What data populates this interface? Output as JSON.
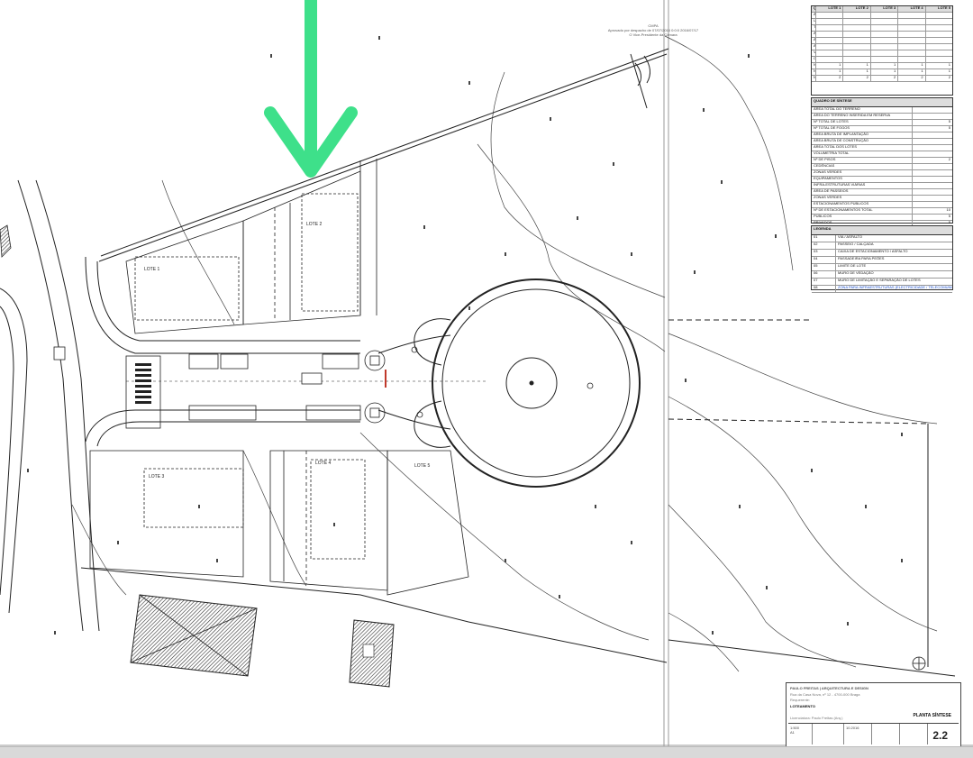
{
  "approval_stamp": {
    "line1": "CMPA",
    "line2": "Aprovado por despacho de 07/07/2016 0:0:0 2016/07/17",
    "line3": "O Vice-Presidente da Câmara"
  },
  "colors": {
    "arrow": "#3ee08a",
    "lines": "#222222",
    "building_hatch": "#333333",
    "legend_blue": "#1a4fd0"
  },
  "annotation": {
    "type": "down-arrow",
    "color": "#3ee08a",
    "points_at": "property boundary line"
  },
  "lot_table": {
    "header": [
      "QUADRO DE SÍNTESE",
      "LOTE 1",
      "LOTE 2",
      "LOTE 3",
      "LOTE 4",
      "LOTE 5"
    ],
    "rows": [
      [
        "ÁREA DO LOTE",
        "",
        "",
        "",
        "",
        ""
      ],
      [
        "USO / OCUPAÇÃO",
        "",
        "",
        "",
        "",
        ""
      ],
      [
        "TIPOLOGIA",
        "",
        "",
        "",
        "",
        ""
      ],
      [
        "ÁREA TOTAL",
        "",
        "",
        "",
        "",
        ""
      ],
      [
        "ÁREA IMPLANTAÇÃO",
        "",
        "",
        "",
        "",
        ""
      ],
      [
        "ÁREA CONSTRUÇÃO",
        "",
        "",
        "",
        "",
        ""
      ],
      [
        "VOLUMETRIA",
        "",
        "",
        "",
        "",
        ""
      ],
      [
        "CÉRCEA MÁXIMA",
        "",
        "",
        "",
        "",
        ""
      ],
      [
        "Nº DE PISOS ACIMA COTA SOLEIRA",
        "1",
        "1",
        "1",
        "1",
        "1"
      ],
      [
        "Nº DE PISOS ABAIXO COTA SOLEIRA",
        "1",
        "1",
        "1",
        "1",
        "1"
      ],
      [
        "Nº ESTACIONAMENTOS / PRIVADO",
        "2",
        "2",
        "2",
        "2",
        "2"
      ]
    ]
  },
  "summary_table": {
    "header": "QUADRO DE SÍNTESE",
    "rows": [
      [
        "ÁREA TOTAL DO TERRENO",
        ""
      ],
      [
        "ÁREA DO TERRENO INSERIDA EM RESERVA",
        ""
      ],
      [
        "Nº TOTAL DE LOTES",
        "5"
      ],
      [
        "Nº TOTAL DE FOGOS",
        "5"
      ],
      [
        "ÁREA BRUTA DE IMPLANTAÇÃO",
        ""
      ],
      [
        "ÁREA BRUTA DE CONSTRUÇÃO",
        ""
      ],
      [
        "ÁREA TOTAL DOS LOTES",
        ""
      ],
      [
        "VOLUMETRIA TOTAL",
        ""
      ],
      [
        "Nº DE PISOS",
        "2"
      ],
      [
        "CEDÊNCIAS",
        ""
      ],
      [
        "ZONAS VERDES",
        ""
      ],
      [
        "EQUIPAMENTOS",
        ""
      ],
      [
        "INFRA-ESTRUTURAS VIÁRIAS",
        ""
      ],
      [
        "ÁREA DE PASSEIOS",
        ""
      ],
      [
        "ZONAS VERDES",
        ""
      ],
      [
        "ESTACIONAMENTOS PÚBLICOS",
        ""
      ],
      [
        "Nº DE ESTACIONAMENTOS TOTAL",
        "10"
      ],
      [
        "PÚBLICOS",
        "5"
      ],
      [
        "PRIVADOS",
        "5"
      ],
      [
        "ÁREA DE IMPERMEABILIZAÇÃO",
        ""
      ]
    ]
  },
  "legend": {
    "header": "LEGENDA",
    "items": [
      {
        "code": "01",
        "text": "VIA / ASFALTO"
      },
      {
        "code": "02",
        "text": "PASSEIO / CALÇADA"
      },
      {
        "code": "03",
        "text": "CAIXA DE ESTACIONAMENTO / ASFALTO"
      },
      {
        "code": "04",
        "text": "PASSADEIRA PARA PEÕES"
      },
      {
        "code": "05",
        "text": "LIMITE DE LOTE"
      },
      {
        "code": "06",
        "text": "MURO DE VEDAÇÃO"
      },
      {
        "code": "07",
        "text": "MURO DE LIMITAÇÃO E SEPARAÇÃO DE LOTES"
      },
      {
        "code": "08",
        "text": "ZONA PARA INFRAESTRUTURAS (ELECTRICIDADE / TELECOMUNICAÇÕES / ÁGUA)",
        "blue": true
      }
    ]
  },
  "lot_labels": [
    "LOTE 1",
    "LOTE 2",
    "LOTE 3",
    "LOTE 4",
    "LOTE 5"
  ],
  "title_block": {
    "office": "PAULO FREITAS | ARQUITECTURA E DESIGN",
    "contact": "Rua da Casa Nova, nº 12 - 4700-000 Braga",
    "requerente": "Requerente:",
    "project": "LOTEAMENTO",
    "author": "Licenciatura: Paulo Freitas (Arq.)",
    "sheet_title": "PLANTA SÍNTESE",
    "scale": "1:500",
    "format": "A1",
    "date": "10.2016",
    "sheet_number": "2.2"
  }
}
